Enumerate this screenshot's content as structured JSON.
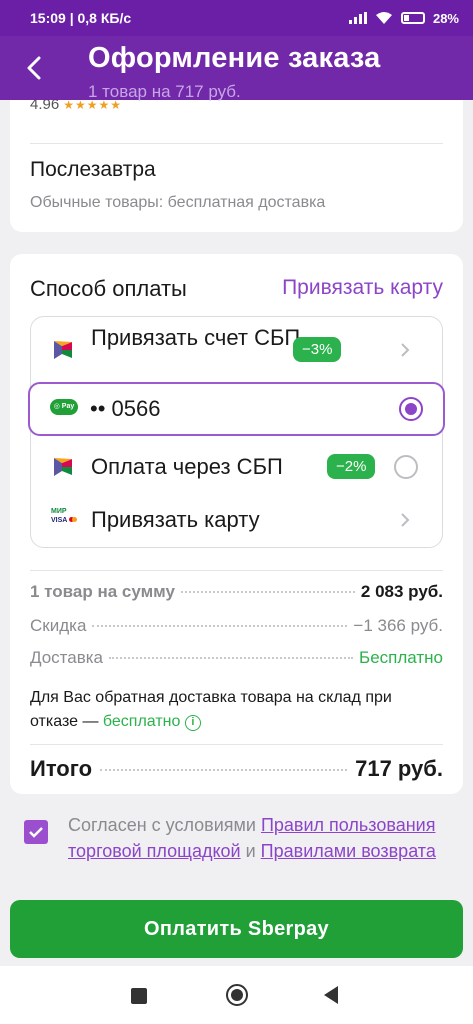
{
  "status_bar": {
    "time": "15:09 | 0,8 КБ/с",
    "battery": "28%"
  },
  "header": {
    "title": "Оформление заказа",
    "subtitle": "1 товар на 717 руб."
  },
  "product_peek": {
    "rating": "4.96"
  },
  "delivery": {
    "title": "Послезавтра",
    "subtitle": "Обычные товары: бесплатная доставка"
  },
  "payment": {
    "title": "Способ оплаты",
    "link_card_label": "Привязать карту",
    "methods": [
      {
        "label": "Привязать счет СБП",
        "badge": "−3%",
        "icon": "sbp-logo-icon",
        "control": "chevron"
      },
      {
        "label": "•• 0566",
        "icon": "sberpay-icon",
        "control": "radio-selected"
      },
      {
        "label": "Оплата через СБП",
        "badge": "−2%",
        "icon": "sbp-logo-icon",
        "control": "radio"
      },
      {
        "label": "Привязать карту",
        "icon": "mir-visa-mastercard-icon",
        "control": "chevron"
      }
    ]
  },
  "summary": {
    "items_label": "1 товар на сумму",
    "items_value": "2 083 руб.",
    "discount_label": "Скидка",
    "discount_value": "−1 366 руб.",
    "delivery_label": "Доставка",
    "delivery_value": "Бесплатно",
    "note_text": "Для Вас обратная доставка товара на склад при отказе — ",
    "note_highlight": "бесплатно",
    "total_label": "Итого",
    "total_value": "717 руб."
  },
  "consent": {
    "prefix": "Согласен с условиями ",
    "link1": "Правил пользования торговой площадкой",
    "middle": " и ",
    "link2": "Правилами возврата",
    "checked": true
  },
  "pay_button": {
    "label": "Оплатить Sberpay"
  },
  "colors": {
    "brand_purple": "#6b1fa6",
    "accent_purple": "#8c45c8",
    "green": "#21a038"
  }
}
